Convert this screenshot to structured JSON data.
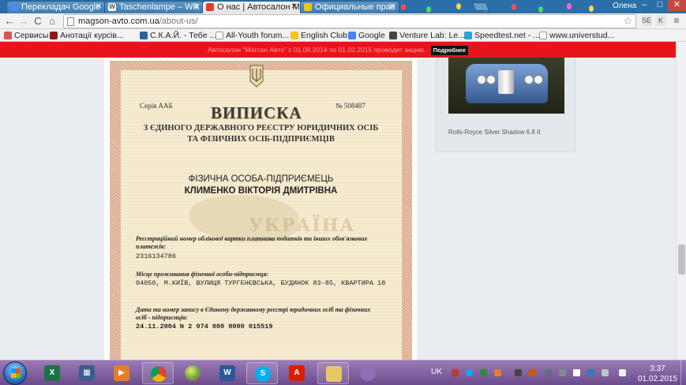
{
  "tabs": [
    {
      "label": "Перекладач Google",
      "favicon_color": "#4a8af4",
      "active": false
    },
    {
      "label": "Taschenlampe – Wik",
      "favicon_color": "#ffffff",
      "active": false
    },
    {
      "label": "О нас | Автосалон М",
      "favicon_color": "#e53935",
      "active": true
    },
    {
      "label": "Официальные прав",
      "favicon_color": "#f0c419",
      "active": false
    }
  ],
  "window": {
    "user": "Олена",
    "minimize": "–",
    "maximize": "□",
    "close": "✕"
  },
  "toolbar": {
    "back": "←",
    "forward": "→",
    "reload": "C",
    "home": "⌂",
    "url_host": "magson-avto.com.ua",
    "url_path": "/about-us/",
    "ext_1": "SE",
    "ext_2": "K",
    "menu": "≡"
  },
  "bookmarks": [
    {
      "label": "Сервисы",
      "color": "#d9534f"
    },
    {
      "label": "Анотації курсів...",
      "color": "#8b1a1a"
    },
    {
      "label": "С.К.А.Й. - Тебе ...",
      "color": "#2a5fa8"
    },
    {
      "label": "All-Youth forum...",
      "color": "#666666"
    },
    {
      "label": "English Club",
      "color": "#1a1a1a"
    },
    {
      "label": "Google",
      "color": "#4285f4"
    },
    {
      "label": "Venture Lab: Le...",
      "color": "#444444"
    },
    {
      "label": "Speedtest.net - ...",
      "color": "#2aa3d8"
    },
    {
      "label": "www.universtud...",
      "color": "#333333"
    }
  ],
  "promo": {
    "text": "Автосалон \"Магсон Авто\" с 01.09.2014 по 01.02.2015 проводит акцию.",
    "button": "Подробнее"
  },
  "sidebar": {
    "car_caption": "Rolls-Royce Silver Shadow 6.8 II"
  },
  "document": {
    "series": "Серія ААБ",
    "number": "№  508487",
    "heading": "ВИПИСКА",
    "sub_1": "З ЄДИНОГО ДЕРЖАВНОГО РЕЄСТРУ ЮРИДИЧНИХ ОСІБ",
    "sub_2": "ТА ФІЗИЧНИХ ОСІБ-ПІДПРИЄМЦІВ",
    "entity_type": "ФІЗИЧНА ОСОБА-ПІДПРИЄМЕЦЬ",
    "entity_name": "КЛИМЕНКО ВІКТОРІЯ ДМИТРІВНА",
    "watermark": "УКРАЇНА",
    "reg_label": "Реєстраційний номер облікової картки платника податків та інших обов'язкових платежів:",
    "reg_value": "2316134786",
    "addr_label": "Місце проживання фізичної особи-підприємця:",
    "addr_value": "04050, М.КИЇВ, ВУЛИЦЯ ТУРГЕНЄВСЬКА, БУДИНОК 83-85, КВАРТИРА 18",
    "date_label": "Дата та номер запису в Єдиному державному реєстрі юридичних осіб та фізичних осіб - підприємців:",
    "date_value": "24.11.2004 № 2 074 000 0000 015519"
  },
  "taskbar": {
    "apps": [
      {
        "icon": "excel-icon",
        "glyph": "X",
        "color": "#1e7145"
      },
      {
        "icon": "video-icon",
        "glyph": "▦",
        "color": "#3a5d8f"
      },
      {
        "icon": "media-player-icon",
        "glyph": "▶",
        "color": "#e0802a"
      },
      {
        "icon": "chrome-icon",
        "glyph": "",
        "color": "#db4437"
      },
      {
        "icon": "ball-icon",
        "glyph": "",
        "color": "#6ab04c"
      },
      {
        "icon": "word-icon",
        "glyph": "W",
        "color": "#2b579a"
      },
      {
        "icon": "skype-icon",
        "glyph": "S",
        "color": "#00aff0"
      },
      {
        "icon": "pdf-icon",
        "glyph": "A",
        "color": "#d81e05"
      },
      {
        "icon": "folder-icon",
        "glyph": "",
        "color": "#e8c766"
      },
      {
        "icon": "paint-icon",
        "glyph": "",
        "color": "#8e6fb5"
      }
    ],
    "language": "UK",
    "time": "3:37",
    "date": "01.02.2015"
  }
}
